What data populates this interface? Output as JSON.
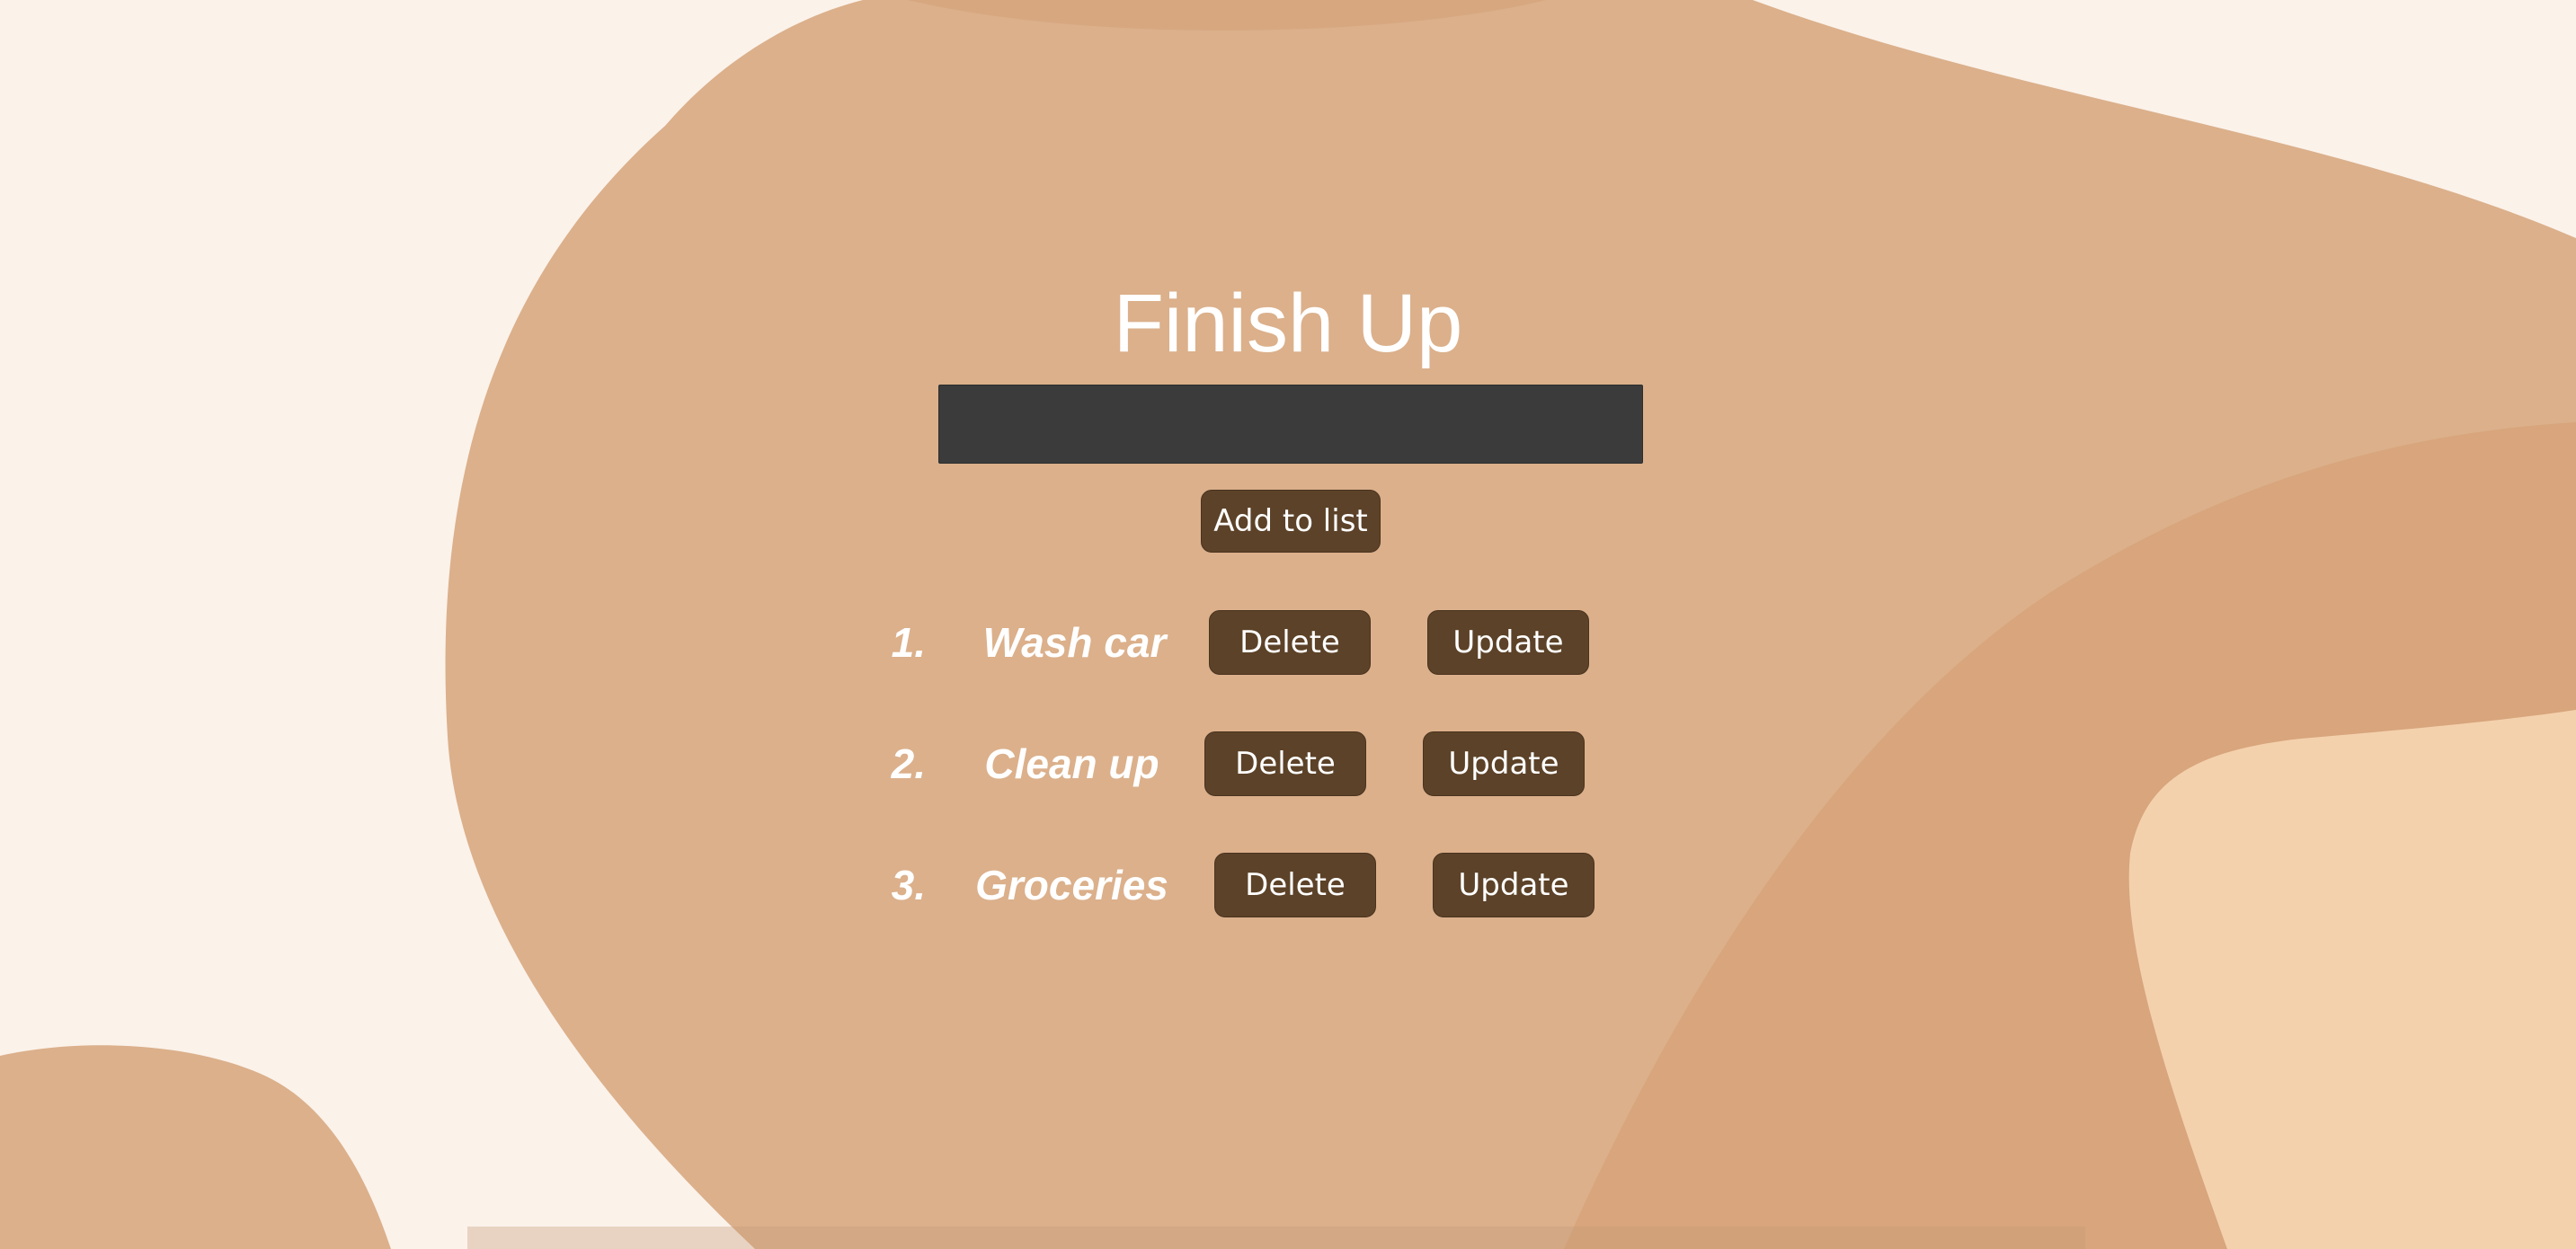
{
  "app": {
    "title": "Finish Up"
  },
  "input": {
    "value": "",
    "placeholder": ""
  },
  "add_button": {
    "label": "Add to list"
  },
  "todos": [
    {
      "number": "1.",
      "text": "Wash car",
      "delete_label": "Delete",
      "update_label": "Update"
    },
    {
      "number": "2.",
      "text": "Clean up",
      "delete_label": "Delete",
      "update_label": "Update"
    },
    {
      "number": "3.",
      "text": "Groceries",
      "delete_label": "Delete",
      "update_label": "Update"
    }
  ],
  "colors": {
    "page_background": "#fbf2ea",
    "blob": "#dbb08b",
    "blob_dark": "#d8a57c",
    "blob_light": "#f4d1ad",
    "input_background": "#3b3b3b",
    "button_background": "#5c4228",
    "text": "#ffffff"
  }
}
